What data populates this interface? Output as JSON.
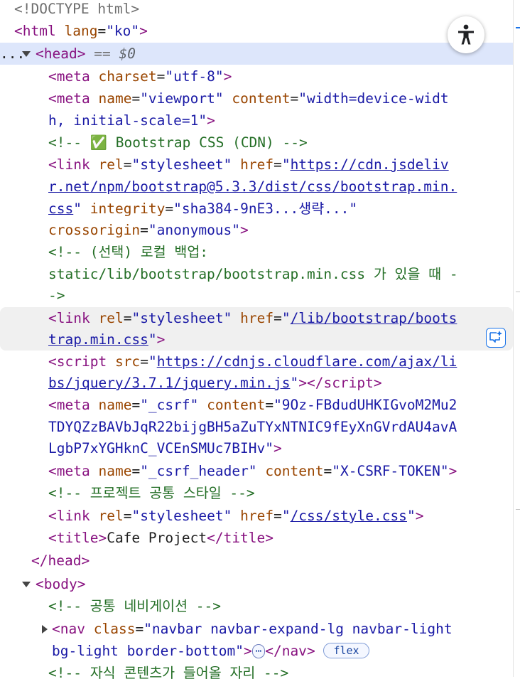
{
  "doctype": "<!DOCTYPE html>",
  "html_open": {
    "tag": "html",
    "attr_name": "lang",
    "attr_value": "\"ko\""
  },
  "head_open": {
    "dots": "...",
    "tag": "head",
    "selected_marker": "== ",
    "selected_var": "$0"
  },
  "meta_charset": {
    "tag": "meta",
    "attr": "charset",
    "value": "\"utf-8\""
  },
  "meta_viewport": {
    "tag": "meta",
    "attr1": "name",
    "val1": "\"viewport\"",
    "attr2": "content",
    "val2_line1": "\"width=device-widt",
    "val2_line2": "h, initial-scale=1\""
  },
  "comment_bootstrap": "<!-- ✅ Bootstrap CSS (CDN) -->",
  "link_cdn": {
    "tag": "link",
    "attr1": "rel",
    "val1": "\"stylesheet\"",
    "attr2": "href",
    "url_line1": "https://cdn.jsdeliv",
    "url_line2": "r.net/npm/bootstrap@5.3.3/dist/css/bootstrap.min.",
    "url_line3": "css",
    "attr3": "integrity",
    "val3": "\"sha384-9nE3...생략...\"",
    "attr4": "crossorigin",
    "val4": "\"anonymous\""
  },
  "comment_local_1": "<!-- (선택) 로컬 백업:",
  "comment_local_2": "static/lib/bootstrap/bootstrap.min.css 가 있을 때 -",
  "comment_local_3": "->",
  "link_local": {
    "tag": "link",
    "attr1": "rel",
    "val1": "\"stylesheet\"",
    "attr2": "href",
    "url_line1": "/lib/bootstrap/boots",
    "url_line2": "trap.min.css"
  },
  "script_jquery": {
    "tag": "script",
    "attr": "src",
    "url_line1": "https://cdnjs.cloudflare.com/ajax/li",
    "url_line2": "bs/jquery/3.7.1/jquery.min.js",
    "close": "script"
  },
  "meta_csrf": {
    "tag": "meta",
    "attr1": "name",
    "val1": "\"_csrf\"",
    "attr2": "content",
    "val2_line1": "\"9Oz-FBdudUHKIGvoM2Mu2",
    "val2_line2": "TDYQZzBAVbJqR22bijgBH5aZuTYxNTNIC9fEyXnGVrdAU4avA",
    "val2_line3": "LgbP7xYGHknC_VCEnSMUc7BIHv\""
  },
  "meta_csrf_header": {
    "tag": "meta",
    "attr1": "name",
    "val1": "\"_csrf_header\"",
    "attr2": "content",
    "val2": "\"X-CSRF-TOKEN\""
  },
  "comment_style": "<!-- 프로젝트 공통 스타일 -->",
  "link_style": {
    "tag": "link",
    "attr1": "rel",
    "val1": "\"stylesheet\"",
    "attr2": "href",
    "url": "/css/style.css"
  },
  "title": {
    "tag": "title",
    "text": "Cafe Project"
  },
  "head_close": "</head>",
  "body_open": "<body>",
  "comment_nav": "<!-- 공통 네비게이션 -->",
  "nav": {
    "tag": "nav",
    "attr": "class",
    "val_line1": "\"navbar navbar-expand-lg navbar-light",
    "val_line2": "bg-light border-bottom\"",
    "ellipsis": "⋯",
    "badge": "flex"
  },
  "comment_child": "<!-- 자식 콘텐츠가 들어올 자리 -->",
  "colors": {
    "tag": "#881280",
    "attr_name": "#994500",
    "attr_value": "#1a1aa6",
    "comment": "#236e25",
    "selection": "#dde6fb"
  },
  "icons": [
    "accessibility-icon",
    "ai-assist-icon",
    "expand-triangle-icon",
    "collapse-triangle-icon"
  ]
}
